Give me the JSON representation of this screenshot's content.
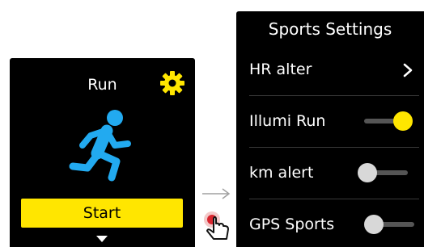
{
  "left_screen": {
    "title": "Run",
    "start_label": "Start",
    "icons": {
      "settings": "gear-icon",
      "activity": "runner-icon",
      "more": "chevron-down-icon"
    },
    "colors": {
      "accent": "#ffe600",
      "runner": "#22aaf0"
    }
  },
  "transition": {
    "icons": [
      "arrow-right-icon",
      "tap-gesture-icon"
    ]
  },
  "right_screen": {
    "title": "Sports Settings",
    "items": [
      {
        "label": "HR alter",
        "control": "chevron"
      },
      {
        "label": "Illumi Run",
        "control": "toggle",
        "on": true
      },
      {
        "label": "km alert",
        "control": "toggle",
        "on": false
      },
      {
        "label": "GPS Sports",
        "control": "toggle",
        "on": false
      }
    ],
    "colors": {
      "toggle_on": "#ffe600",
      "toggle_off": "#d8d8d8"
    }
  }
}
